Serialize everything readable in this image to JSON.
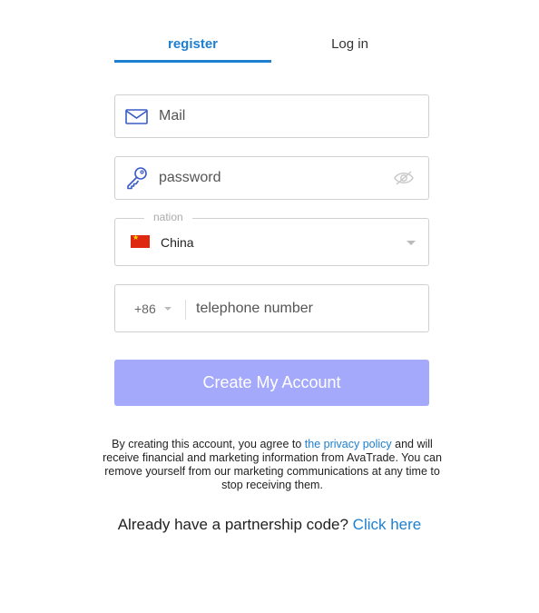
{
  "tabs": {
    "register": "register",
    "login": "Log in",
    "active": "register"
  },
  "mail": {
    "placeholder": "Mail",
    "icon": "mail-icon"
  },
  "password": {
    "placeholder": "password",
    "icon": "key-icon",
    "toggle_icon": "eye-icon"
  },
  "nation": {
    "legend": "nation",
    "value": "China",
    "flag": "china-flag-icon"
  },
  "phone": {
    "code": "+86",
    "placeholder": "telephone number"
  },
  "create_button": "Create My Account",
  "terms": {
    "before": "By creating this account, you agree to ",
    "link": "the privacy policy",
    "after": " and will receive financial and marketing information from AvaTrade. You can remove yourself from our marketing communications at any time to stop receiving them."
  },
  "partner": {
    "text": "Already have a partnership code? ",
    "link": "Click here"
  },
  "colors": {
    "accent": "#1e7fd0",
    "button_disabled": "#a4a9fb",
    "icon": "#3a5bc7"
  }
}
